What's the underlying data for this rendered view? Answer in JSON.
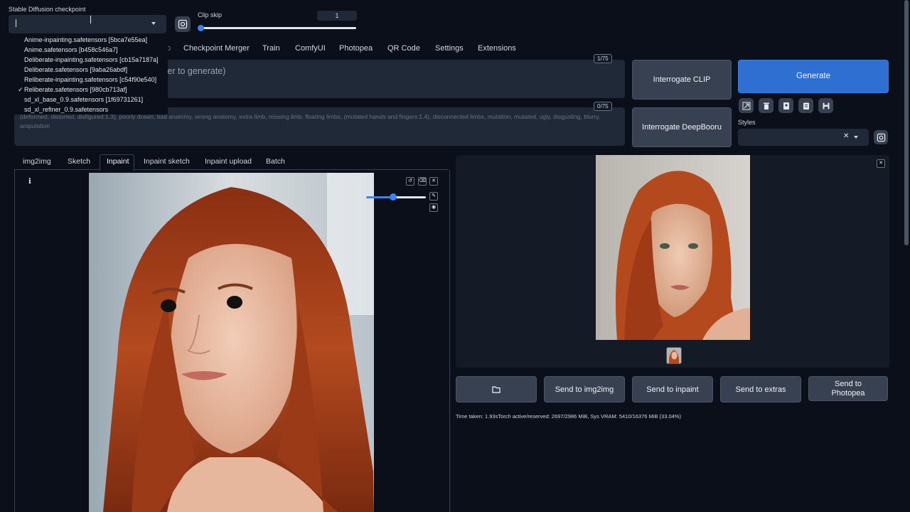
{
  "checkpoint": {
    "label": "Stable Diffusion checkpoint",
    "value": "",
    "options": [
      {
        "label": "Anime-inpainting.safetensors [5bca7e55ea]",
        "selected": false
      },
      {
        "label": "Anime.safetensors [b458c546a7]",
        "selected": false
      },
      {
        "label": "Deliberate-inpainting.safetensors [cb15a7187a]",
        "selected": false
      },
      {
        "label": "Deliberate.safetensors [9aba26abdf]",
        "selected": false
      },
      {
        "label": "Reliberate-inpainting.safetensors [c54f90e540]",
        "selected": false
      },
      {
        "label": "Reliberate.safetensors [980cb713af]",
        "selected": true
      },
      {
        "label": "sd_xl_base_0.9.safetensors [1f69731261]",
        "selected": false
      },
      {
        "label": "sd_xl_refiner_0.9.safetensors",
        "selected": false
      }
    ],
    "check_mark": "✓"
  },
  "clip_skip": {
    "label": "Clip skip",
    "value": "1",
    "slider_fraction": 0.0
  },
  "tabs": [
    "PNG Info",
    "Checkpoint Merger",
    "Train",
    "ComfyUI",
    "Photopea",
    "QR Code",
    "Settings",
    "Extensions"
  ],
  "prompt": {
    "counter": "1/75",
    "placeholder_fragment": "nter to generate)"
  },
  "negative_prompt": {
    "counter": "0/75",
    "text": "(deformed, distorted, disfigured:1.3), poorly drawn, bad anatomy, wrong anatomy, extra limb, missing limb, floating limbs, (mutated hands and fingers:1.4), disconnected limbs, mutation, mutated, ugly, disgusting, blurry, amputation"
  },
  "buttons": {
    "interrogate_clip": "Interrogate CLIP",
    "interrogate_deepbooru": "Interrogate DeepBooru",
    "generate": "Generate"
  },
  "styles": {
    "label": "Styles",
    "clear_glyph": "✕"
  },
  "img2img_tabs": [
    "img2img",
    "Sketch",
    "Inpaint",
    "Inpaint sketch",
    "Inpaint upload",
    "Batch"
  ],
  "active_img2img_tab": "Inpaint",
  "inpaint": {
    "brush_fraction": 0.45
  },
  "output_actions": {
    "folder": "",
    "send_img2img": "Send to img2img",
    "send_inpaint": "Send to inpaint",
    "send_extras": "Send to extras",
    "send_photopea": "Send to Photopea"
  },
  "status_text": "Time taken: 1.93sTorch active/reserved: 2697/2986 MiB, Sys VRAM: 5410/16376 MiB (33.04%)",
  "colors": {
    "accent": "#2f6fd1",
    "background": "#0b0f19",
    "panel": "#1f2937"
  }
}
